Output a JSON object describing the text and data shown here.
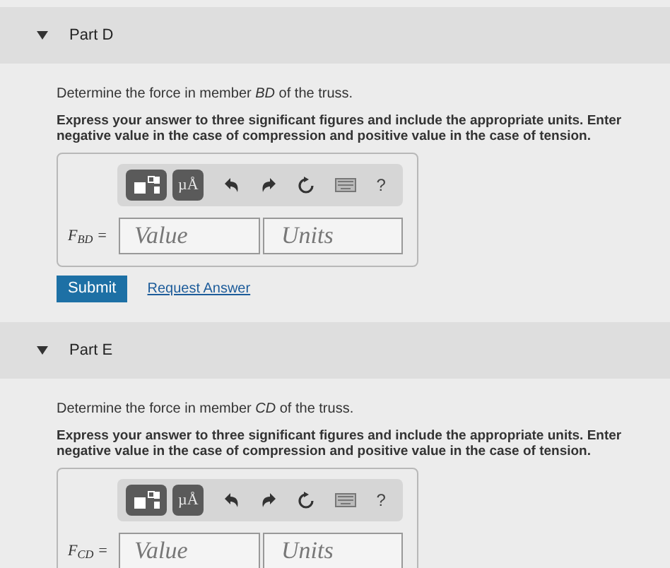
{
  "parts": [
    {
      "title": "Part D",
      "expanded": true,
      "prompt": "Determine the force in member *BD* of the truss.",
      "instruction": "Express your answer to three significant figures and include the appropriate units. Enter negative value in the case of compression and positive value in the case of tension.",
      "toolbar": {
        "units_label": "µÅ",
        "help": "?"
      },
      "answer_label": "F$_{BD}$ =",
      "value_placeholder": "Value",
      "units_placeholder": "Units",
      "actions": {
        "submit": "Submit",
        "request": "Request Answer"
      }
    },
    {
      "title": "Part E",
      "expanded": true,
      "prompt": "Determine the force in member *CD* of the truss.",
      "instruction": "Express your answer to three significant figures and include the appropriate units. Enter negative value in the case of compression and positive value in the case of tension.",
      "toolbar": {
        "units_label": "µÅ",
        "help": "?"
      },
      "answer_label": "F$_{CD}$ =",
      "value_placeholder": "Value",
      "units_placeholder": "Units"
    }
  ]
}
